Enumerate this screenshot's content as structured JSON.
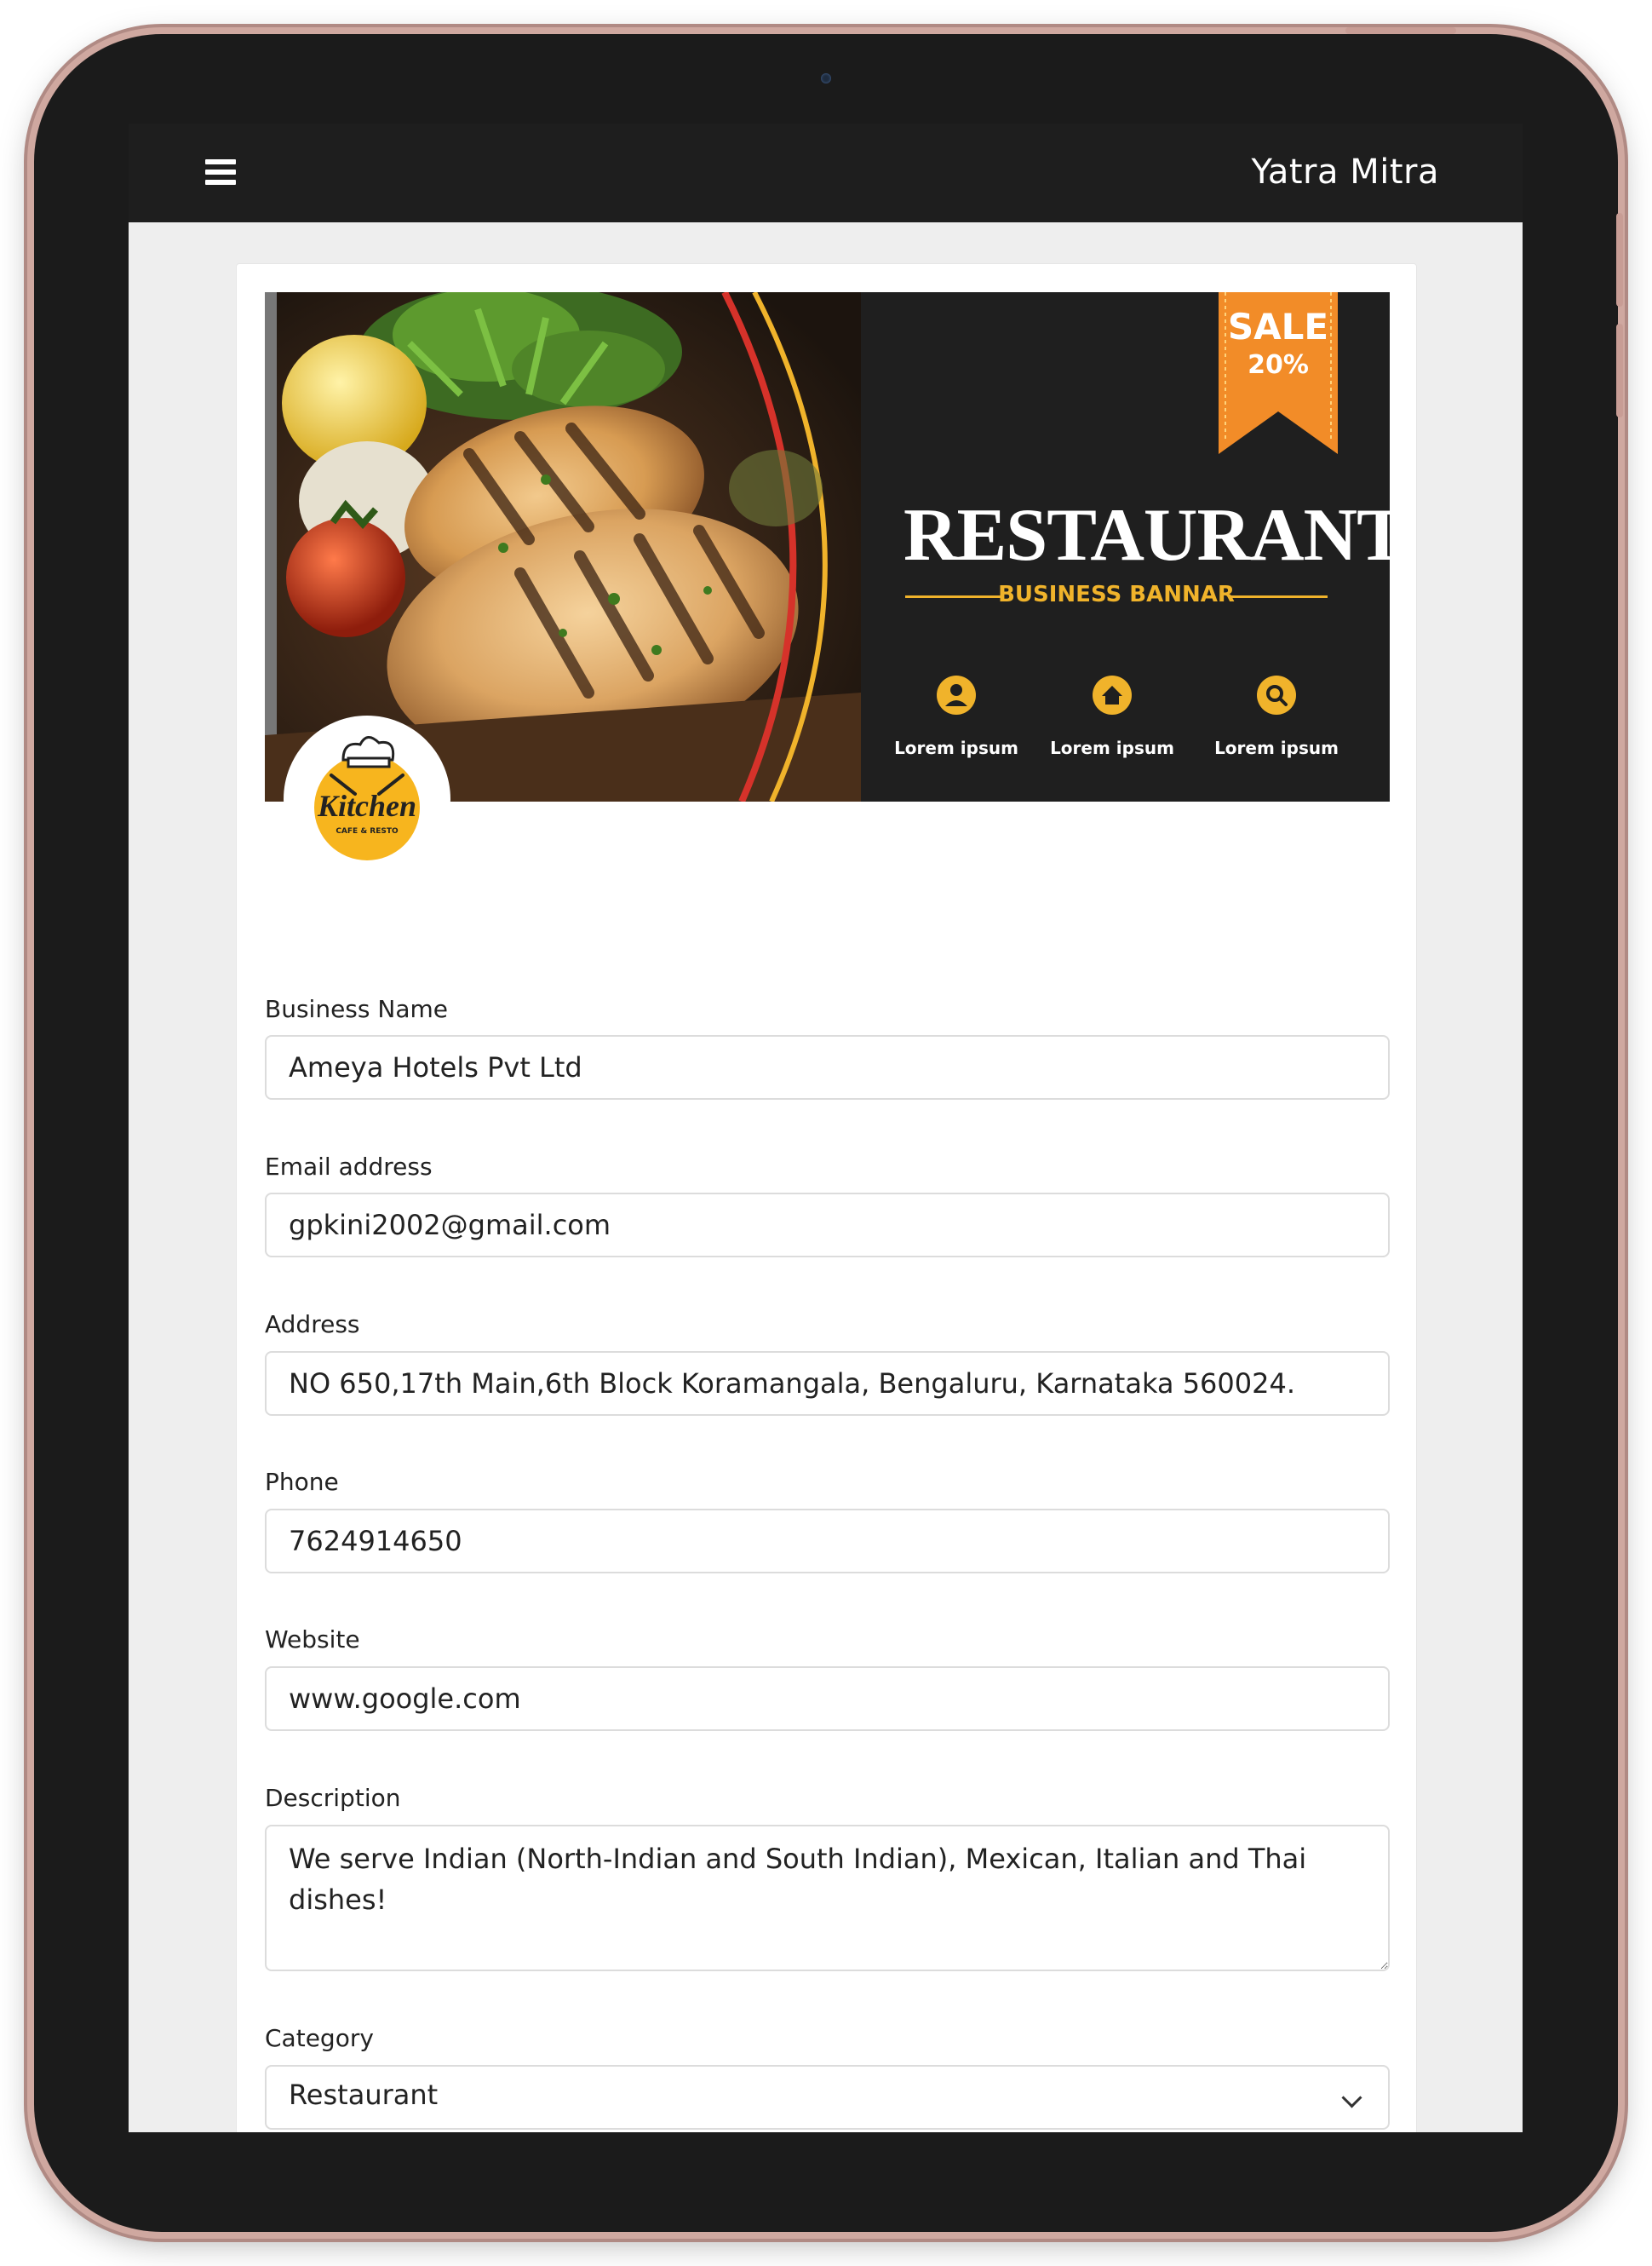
{
  "app": {
    "title": "Yatra Mitra"
  },
  "banner": {
    "sale_label": "SALE",
    "sale_percent": "20%",
    "heading": "RESTAURANT",
    "subheading": "BUSINESS BANNAR",
    "features": [
      {
        "icon": "user-icon",
        "label": "Lorem ipsum"
      },
      {
        "icon": "home-icon",
        "label": "Lorem ipsum"
      },
      {
        "icon": "search-icon",
        "label": "Lorem ipsum"
      }
    ]
  },
  "logo": {
    "text": "Kitchen",
    "subtext": "CAFE & RESTO"
  },
  "form": {
    "business_name": {
      "label": "Business Name",
      "value": "Ameya Hotels Pvt Ltd"
    },
    "email": {
      "label": "Email address",
      "value": "gpkini2002@gmail.com"
    },
    "address": {
      "label": "Address",
      "value": "NO 650,17th Main,6th Block Koramangala, Bengaluru, Karnataka 560024."
    },
    "phone": {
      "label": "Phone",
      "value": "7624914650"
    },
    "website": {
      "label": "Website",
      "value": "www.google.com"
    },
    "description": {
      "label": "Description",
      "value": "We serve Indian (North-Indian and South Indian), Mexican, Italian and Thai dishes!"
    },
    "category": {
      "label": "Category",
      "value": "Restaurant"
    }
  },
  "colors": {
    "appbar": "#1e1e1e",
    "accent": "#f0b32b",
    "banner_bg": "#1f1f1f",
    "sale_orange": "#f28c28"
  }
}
